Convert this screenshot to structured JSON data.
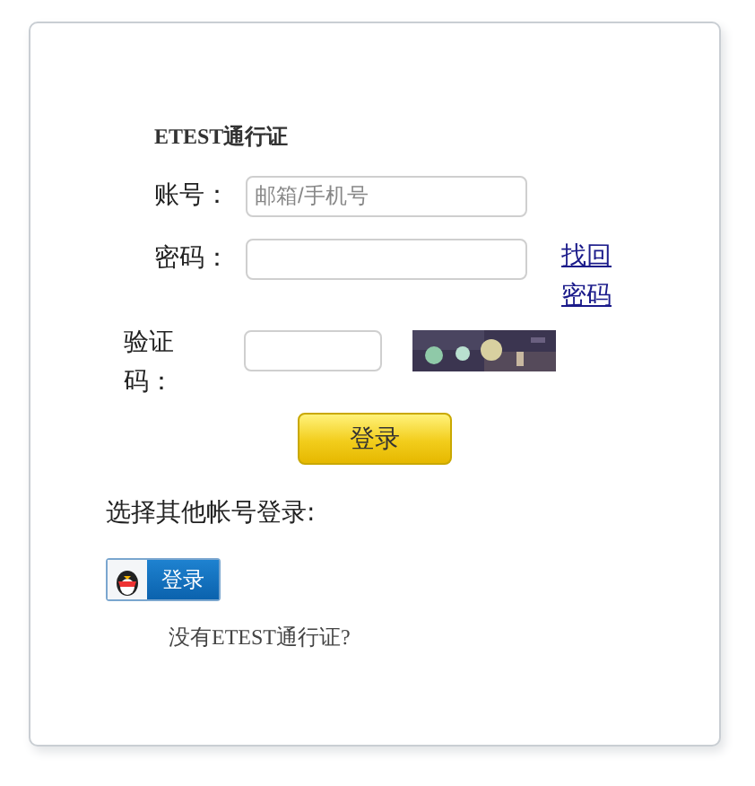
{
  "title": "ETEST通行证",
  "account": {
    "label": "账号：",
    "placeholder": "邮箱/手机号"
  },
  "password": {
    "label": "密码：",
    "link": "找回密码"
  },
  "captcha": {
    "label": "验证码："
  },
  "login_button": "登录",
  "other_login": {
    "label": "选择其他帐号登录:",
    "qq_button": "登录"
  },
  "register_prompt": "没有ETEST通行证?"
}
